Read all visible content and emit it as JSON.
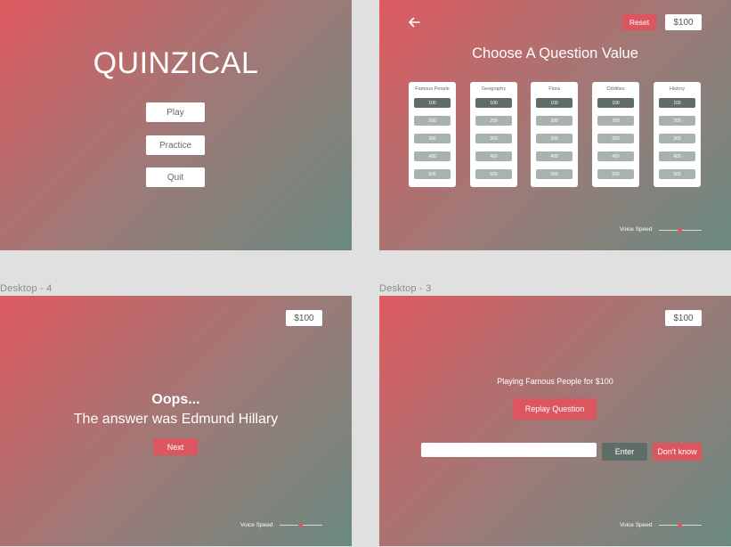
{
  "frames": {
    "menu": {
      "logo": "QUINZICAL",
      "buttons": [
        "Play",
        "Practice",
        "Quit"
      ]
    },
    "choose": {
      "reset_label": "Reset",
      "money": "$100",
      "heading": "Choose A Question Value",
      "categories": [
        {
          "title": "Famous People",
          "values": [
            "100",
            "200",
            "300",
            "400",
            "500"
          ]
        },
        {
          "title": "Geography",
          "values": [
            "100",
            "200",
            "300",
            "400",
            "500"
          ]
        },
        {
          "title": "Flora",
          "values": [
            "100",
            "200",
            "300",
            "400",
            "500"
          ]
        },
        {
          "title": "Oddities",
          "values": [
            "100",
            "200",
            "300",
            "400",
            "500"
          ]
        },
        {
          "title": "History",
          "values": [
            "100",
            "200",
            "300",
            "400",
            "500"
          ]
        }
      ],
      "voice_speed_label": "Voice Speed",
      "voice_speed": 0.5
    },
    "result": {
      "frame_title": "Desktop - 4",
      "money": "$100",
      "headline": "Oops...",
      "message": "The answer was Edmund Hillary",
      "next_label": "Next",
      "voice_speed_label": "Voice Speed",
      "voice_speed": 0.5
    },
    "question": {
      "frame_title": "Desktop - 3",
      "money": "$100",
      "prompt": "Playing Famous People for $100",
      "replay_label": "Replay Question",
      "answer_value": "",
      "enter_label": "Enter",
      "dont_know_label": "Don't know",
      "voice_speed_label": "Voice Speed",
      "voice_speed": 0.5
    }
  },
  "colors": {
    "gradient_start": "#de5a60",
    "gradient_end": "#6a8a80",
    "accent_red": "#dc5660",
    "dark_slate": "#5e6e67",
    "light_slate": "#a8b3ae",
    "canvas_bg": "#e0e0e0"
  }
}
